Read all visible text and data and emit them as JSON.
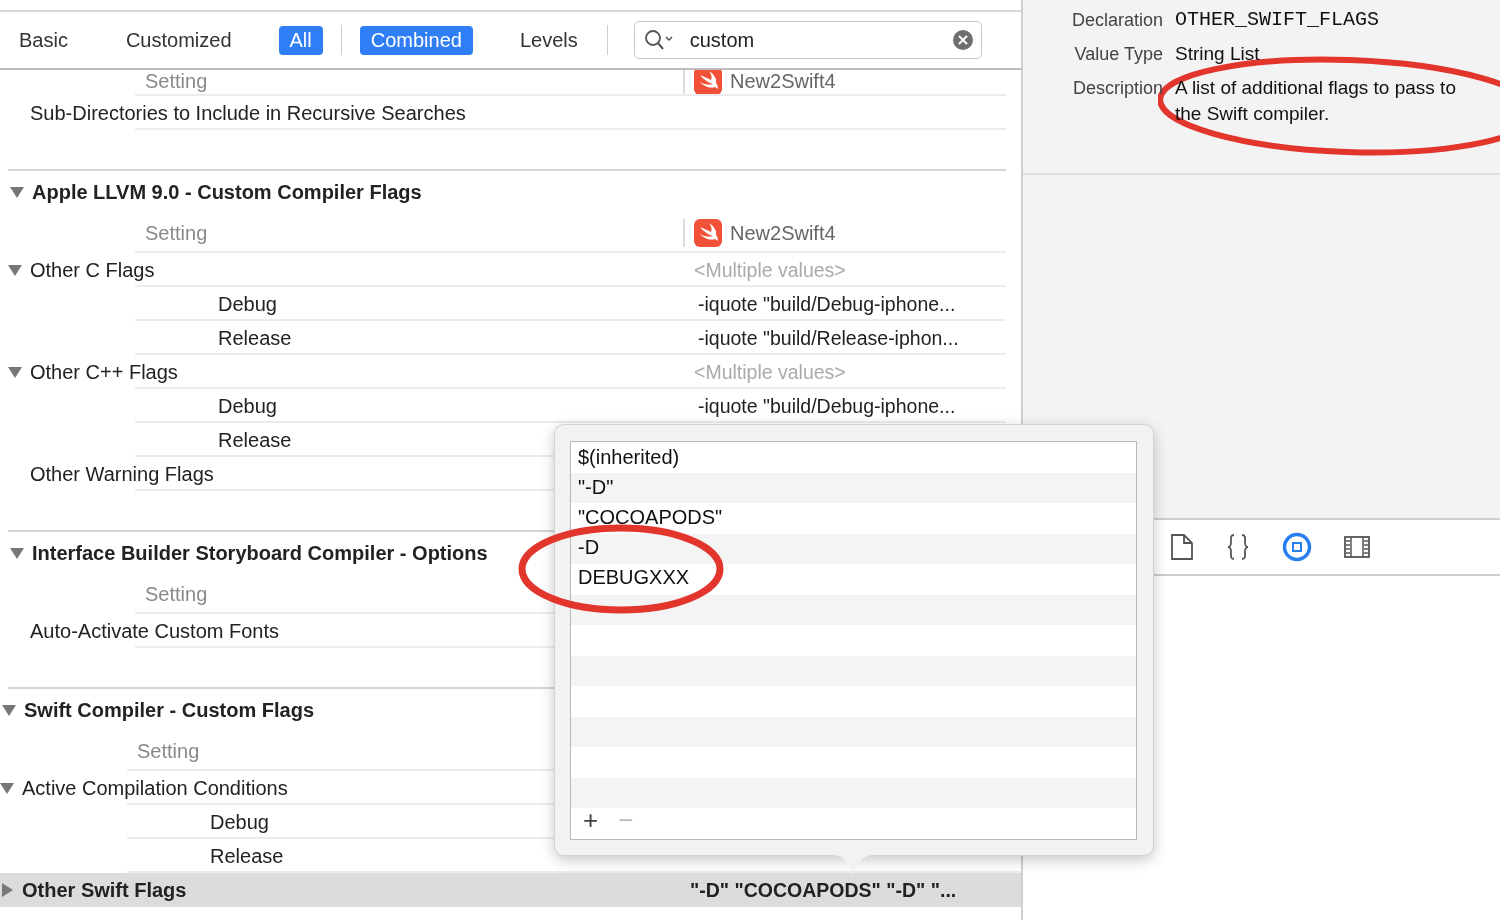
{
  "filter_tabs": [
    {
      "label": "Basic",
      "selected": false
    },
    {
      "label": "Customized",
      "selected": false
    },
    {
      "label": "All",
      "selected": true
    }
  ],
  "view_tabs": [
    {
      "label": "Combined",
      "selected": true
    },
    {
      "label": "Levels",
      "selected": false
    }
  ],
  "search": {
    "value": "custom"
  },
  "groups": [
    {
      "rows": [
        {
          "kind": "column_header",
          "label": "Setting",
          "target": "New2Swift4"
        },
        {
          "kind": "setting",
          "name": "Sub-Directories to Include in Recursive Searches",
          "selected": false,
          "customized": false
        }
      ]
    },
    {
      "title": "Apple LLVM 9.0 - Custom Compiler Flags",
      "expanded": true,
      "rows": [
        {
          "kind": "column_header",
          "label": "Setting",
          "target": "New2Swift4"
        },
        {
          "kind": "setting",
          "name": "Other C Flags",
          "expanded": true,
          "value": "<Multiple values>",
          "selected": false,
          "customized": false,
          "children": [
            {
              "name": "Debug",
              "value": "-iquote \"build/Debug-iphone..."
            },
            {
              "name": "Release",
              "value": "-iquote \"build/Release-iphon..."
            }
          ]
        },
        {
          "kind": "setting",
          "name": "Other C++ Flags",
          "expanded": true,
          "value": "<Multiple values>",
          "selected": false,
          "customized": false,
          "children": [
            {
              "name": "Debug",
              "value": "-iquote \"build/Debug-iphone..."
            },
            {
              "name": "Release"
            }
          ]
        },
        {
          "kind": "setting",
          "name": "Other Warning Flags",
          "selected": false,
          "customized": false
        }
      ]
    },
    {
      "title": "Interface Builder Storyboard Compiler - Options",
      "expanded": true,
      "rows": [
        {
          "kind": "column_header",
          "label": "Setting"
        },
        {
          "kind": "setting",
          "name": "Auto-Activate Custom Fonts",
          "selected": false,
          "customized": false
        }
      ]
    },
    {
      "title": "Swift Compiler - Custom Flags",
      "expanded": true,
      "rows": [
        {
          "kind": "column_header",
          "label": "Setting"
        },
        {
          "kind": "setting",
          "name": "Active Compilation Conditions",
          "expanded": true,
          "selected": false,
          "customized": false,
          "children": [
            {
              "name": "Debug"
            },
            {
              "name": "Release"
            }
          ]
        },
        {
          "kind": "setting",
          "name": "Other Swift Flags",
          "expanded": false,
          "value": "\"-D\" \"COCOAPODS\" \"-D\" \"...",
          "selected": true,
          "customized": true
        }
      ]
    }
  ],
  "popover": {
    "items": [
      "$(inherited)",
      "\"-D\"",
      "\"COCOAPODS\"",
      "-D",
      "DEBUGXXX"
    ],
    "add_button": "+",
    "remove_button": {
      "label": "−",
      "disabled": true
    }
  },
  "inspector": {
    "fields": [
      {
        "label": "Declaration",
        "value": "OTHER_SWIFT_FLAGS",
        "kind": "code"
      },
      {
        "label": "Value Type",
        "value": "String List",
        "kind": "text"
      },
      {
        "label": "Description",
        "value": "A list of additional flags to pass to the Swift compiler.",
        "kind": "text"
      }
    ],
    "tabs": [
      {
        "kind": "file",
        "selected": false
      },
      {
        "kind": "braces",
        "selected": false
      },
      {
        "kind": "object",
        "selected": true
      },
      {
        "kind": "media",
        "selected": false
      }
    ]
  }
}
